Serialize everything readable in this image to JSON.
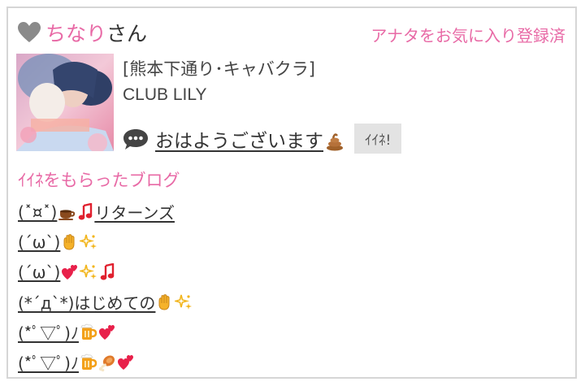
{
  "header": {
    "user_name": "ちなり",
    "honorific": "さん",
    "favorite_status": "アナタをお気に入り登録済"
  },
  "shop": {
    "type": "[熊本下通り･キャバクラ]",
    "name": "CLUB LILY"
  },
  "post": {
    "title": "おはようございます",
    "like_button": "ｲｲﾈ!"
  },
  "liked_blogs": {
    "title": "ｲｲﾈをもらったブログ",
    "items": [
      {
        "text": "(˟¤˟)",
        "suffix": "リターンズ",
        "emojis": [
          "coffee-icon",
          "music-note-icon"
        ]
      },
      {
        "text": "(´ω`)",
        "suffix": "",
        "emojis": [
          "clap-icon",
          "sparkles-icon"
        ]
      },
      {
        "text": "(´ω`)",
        "suffix": "",
        "emojis": [
          "two-hearts-icon",
          "sparkles-icon",
          "music-note-icon"
        ]
      },
      {
        "text": "(*´д`*)はじめての",
        "suffix": "",
        "emojis": [
          "clap-icon",
          "sparkles-icon"
        ]
      },
      {
        "text": "(*ﾟ▽ﾟ)ﾉ",
        "suffix": "",
        "emojis": [
          "beer-icon",
          "two-hearts-icon"
        ]
      },
      {
        "text": "(*ﾟ▽ﾟ)ﾉ",
        "suffix": "",
        "emojis": [
          "beer-icon",
          "meat-icon",
          "two-hearts-icon"
        ]
      }
    ]
  },
  "colors": {
    "accent": "#e86aa6",
    "text": "#333333",
    "border": "#d6d6d6"
  }
}
